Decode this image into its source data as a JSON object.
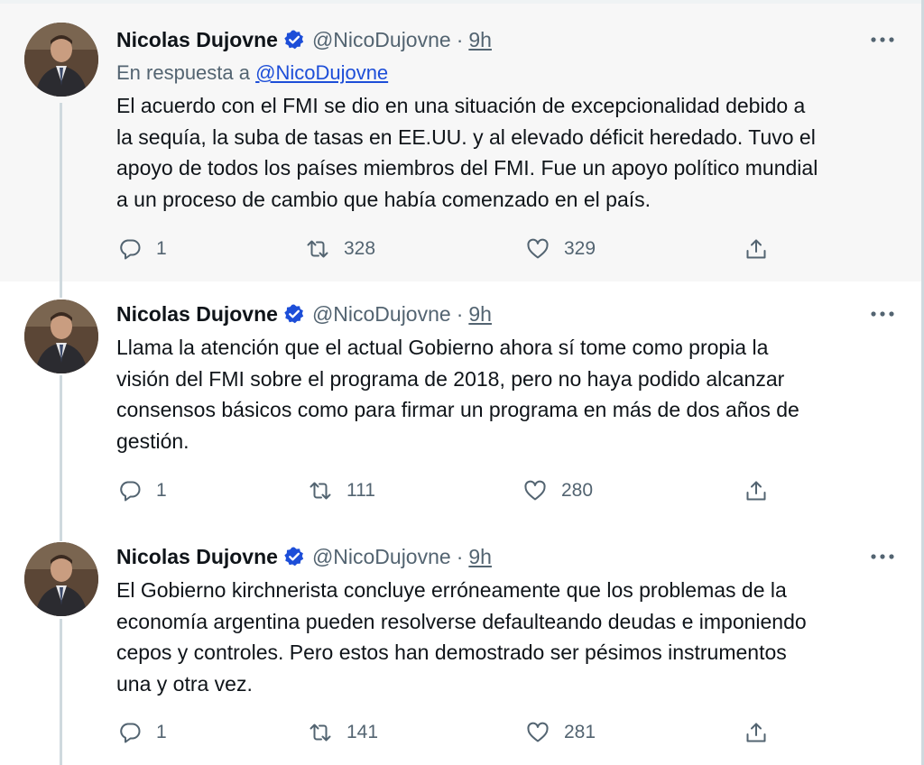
{
  "tweets": [
    {
      "name": "Nicolas Dujovne",
      "handle": "@NicoDujovne",
      "separator": "·",
      "time": "9h",
      "reply_prefix": "En respuesta a",
      "reply_handle": "@NicoDujovne",
      "text": "El acuerdo con el FMI se dio en una situación de excepcionalidad debido a\nla sequía, la suba de tasas en EE.UU. y al elevado déficit heredado. Tuvo el\napoyo de todos los países miembros del FMI. Fue un apoyo político mundial\na un proceso de cambio que había comenzado en el país.",
      "replies": "1",
      "retweets": "328",
      "likes": "329"
    },
    {
      "name": "Nicolas Dujovne",
      "handle": "@NicoDujovne",
      "separator": "·",
      "time": "9h",
      "text": "Llama la atención que el actual Gobierno ahora sí tome como propia la\nvisión del FMI sobre el programa de 2018, pero no haya podido alcanzar\nconsensos básicos como para firmar un programa en más de dos años de\ngestión.",
      "replies": "1",
      "retweets": "111",
      "likes": "280"
    },
    {
      "name": "Nicolas Dujovne",
      "handle": "@NicoDujovne",
      "separator": "·",
      "time": "9h",
      "text": "El Gobierno kirchnerista concluye erróneamente que los problemas de la\neconomía argentina pueden resolverse defaulteando deudas e imponiendo\ncepos y controles. Pero estos han demostrado ser pésimos instrumentos\nuna y otra vez.",
      "replies": "1",
      "retweets": "141",
      "likes": "281"
    }
  ],
  "icons": {
    "verified": "verified-badge-icon",
    "more": "more-options-icon",
    "reply": "reply-icon",
    "retweet": "retweet-icon",
    "like": "heart-icon",
    "share": "share-icon"
  },
  "colors": {
    "verified_badge": "#1d4ed8",
    "link": "#1d4ed8",
    "secondary_text": "#536471",
    "highlighted_background": "#f7f7f7"
  }
}
